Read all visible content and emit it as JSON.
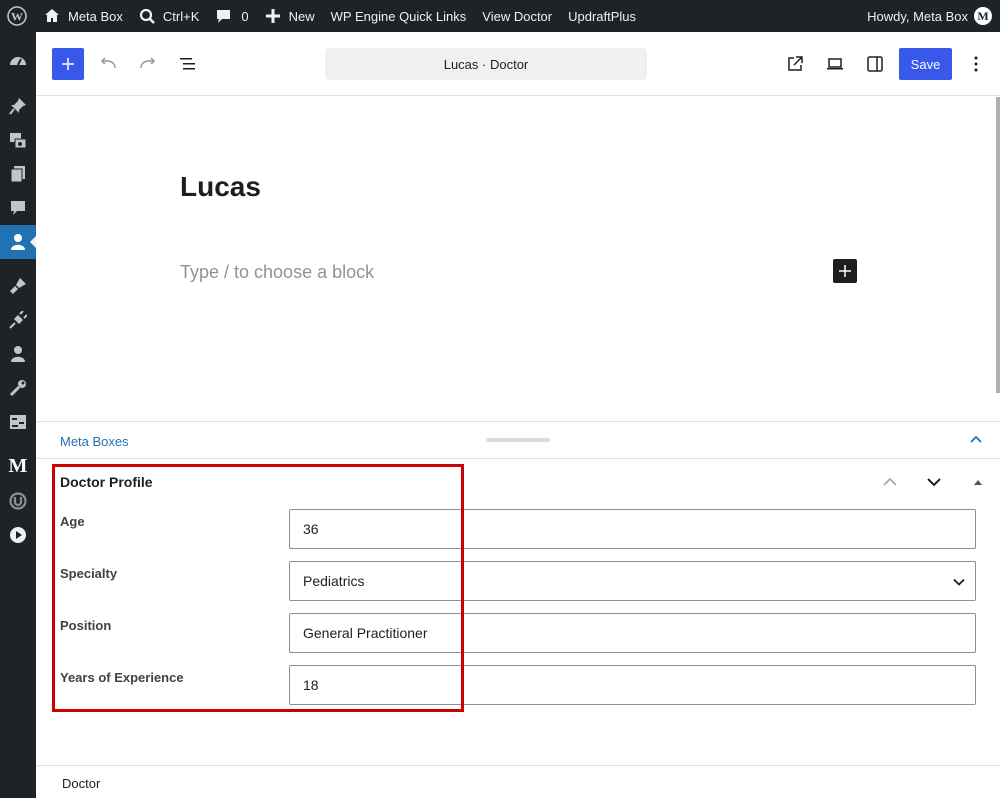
{
  "admin_bar": {
    "site_name": "Meta Box",
    "search_shortcut": "Ctrl+K",
    "comments_count": "0",
    "new_label": "New",
    "quick_links": "WP Engine Quick Links",
    "view_doctor": "View Doctor",
    "updraft": "UpdraftPlus",
    "howdy": "Howdy, Meta Box",
    "avatar_letter": "M"
  },
  "sidebar": {
    "icons": [
      "dashboard-icon",
      "pin-icon",
      "media-icon",
      "pages-icon",
      "comments-icon",
      "users-active-icon",
      "appearance-icon",
      "plugins-icon",
      "users-icon",
      "tools-icon",
      "settings-icon",
      "metabox-icon",
      "updraft-icon",
      "play-icon"
    ],
    "metabox_letter": "M"
  },
  "toolbar": {
    "document_title": "Lucas · Doctor",
    "save_label": "Save"
  },
  "editor": {
    "post_title": "Lucas",
    "block_placeholder": "Type / to choose a block"
  },
  "meta_boxes": {
    "label": "Meta Boxes"
  },
  "doctor_profile": {
    "title": "Doctor Profile",
    "fields": [
      {
        "label": "Age",
        "value": "36"
      },
      {
        "label": "Specialty",
        "value": "Pediatrics"
      },
      {
        "label": "Position",
        "value": "General Practitioner"
      },
      {
        "label": "Years of Experience",
        "value": "18"
      }
    ]
  },
  "footer": {
    "breadcrumb": "Doctor"
  },
  "colors": {
    "admin_bg": "#1d2327",
    "accent": "#3858e9",
    "highlight_border": "#cc0000",
    "link": "#2271b1"
  }
}
